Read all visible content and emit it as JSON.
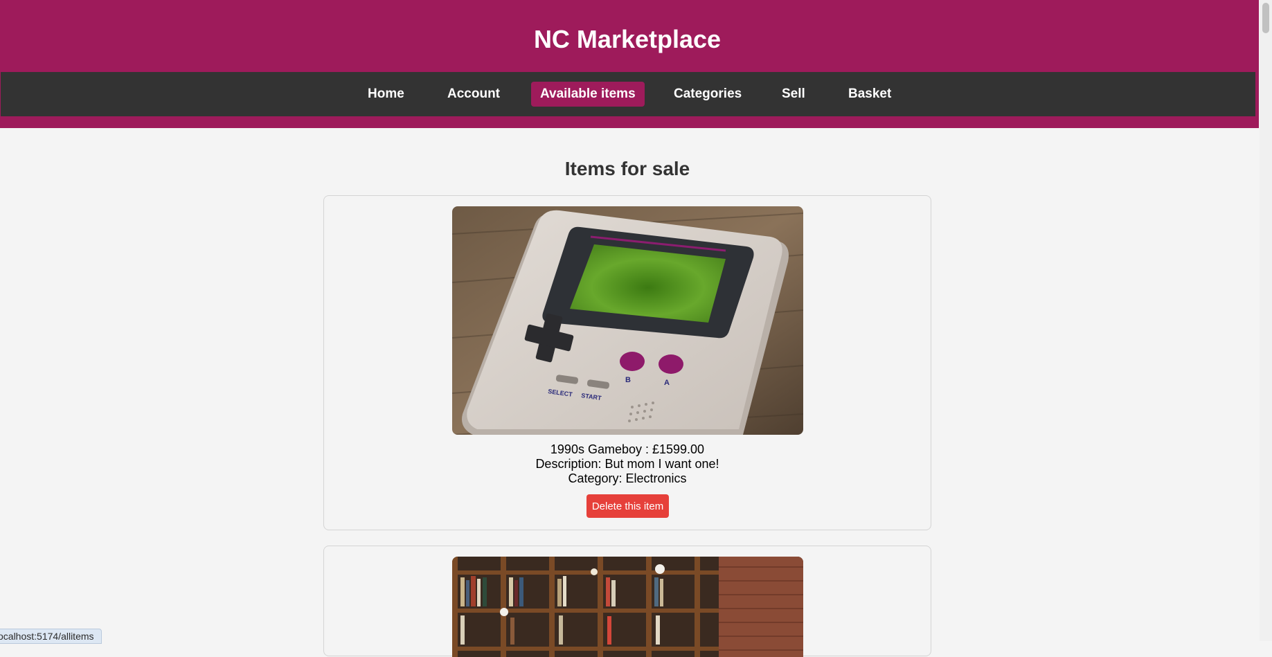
{
  "header": {
    "title": "NC Marketplace"
  },
  "nav": {
    "items": [
      {
        "label": "Home"
      },
      {
        "label": "Account"
      },
      {
        "label": "Available items",
        "active": true
      },
      {
        "label": "Categories"
      },
      {
        "label": "Sell"
      },
      {
        "label": "Basket"
      }
    ]
  },
  "colors": {
    "brand": "#9e1b5b",
    "nav_background": "#333333",
    "delete_button": "#e6403a",
    "page_background": "#f4f4f4"
  },
  "main": {
    "heading": "Items for sale",
    "items": [
      {
        "title_line": "1990s Gameboy : £1599.00",
        "description_line": "Description: But mom I want one!",
        "category_line": "Category: Electronics",
        "delete_label": "Delete this item",
        "image_subject": "gameboy-photo",
        "button_labels": {
          "select": "SELECT",
          "start": "START",
          "b": "B",
          "a": "A"
        }
      },
      {
        "image_subject": "bookshelf-photo"
      }
    ]
  },
  "status_bar": {
    "url": "ocalhost:5174/allitems"
  }
}
